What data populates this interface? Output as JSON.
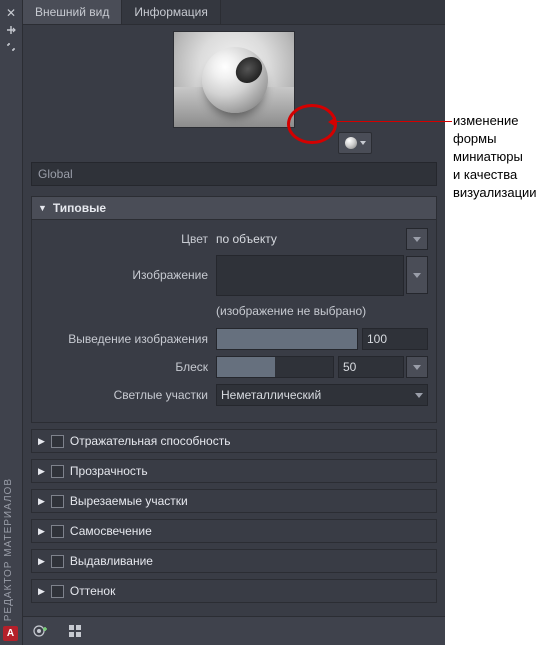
{
  "gutter": {
    "vertical_label": "РЕДАКТОР МАТЕРИАЛОВ",
    "badge": "A",
    "icons": [
      "close-icon",
      "pin-icon",
      "collapse-icon"
    ]
  },
  "tabs": [
    {
      "id": "appearance",
      "label": "Внешний вид",
      "active": true
    },
    {
      "id": "info",
      "label": "Информация",
      "active": false
    }
  ],
  "swatch": {
    "icon": "sphere-icon"
  },
  "annotation": {
    "line1": "изменение",
    "line2": "формы",
    "line3": "миниатюры",
    "line4": "и качества",
    "line5": "визуализации"
  },
  "name_field": "Global",
  "section_generic": {
    "title": "Типовые",
    "rows": {
      "color": {
        "label": "Цвет",
        "value": "по объекту"
      },
      "image": {
        "label": "Изображение",
        "value": ""
      },
      "image_note": "(изображение не выбрано)",
      "image_fade": {
        "label": "Выведение изображения",
        "value": "100",
        "fill_pct": 100
      },
      "gloss": {
        "label": "Блеск",
        "value": "50",
        "fill_pct": 50
      },
      "highlights": {
        "label": "Светлые участки",
        "value": "Неметаллический"
      }
    }
  },
  "collapsed_sections": [
    {
      "id": "reflect",
      "label": "Отражательная способность"
    },
    {
      "id": "transp",
      "label": "Прозрачность"
    },
    {
      "id": "cutout",
      "label": "Вырезаемые участки"
    },
    {
      "id": "selfillum",
      "label": "Самосвечение"
    },
    {
      "id": "bump",
      "label": "Выдавливание"
    },
    {
      "id": "tint",
      "label": "Оттенок"
    }
  ],
  "bottombar": {
    "icons": [
      "create-material-icon",
      "grid-view-icon"
    ]
  }
}
